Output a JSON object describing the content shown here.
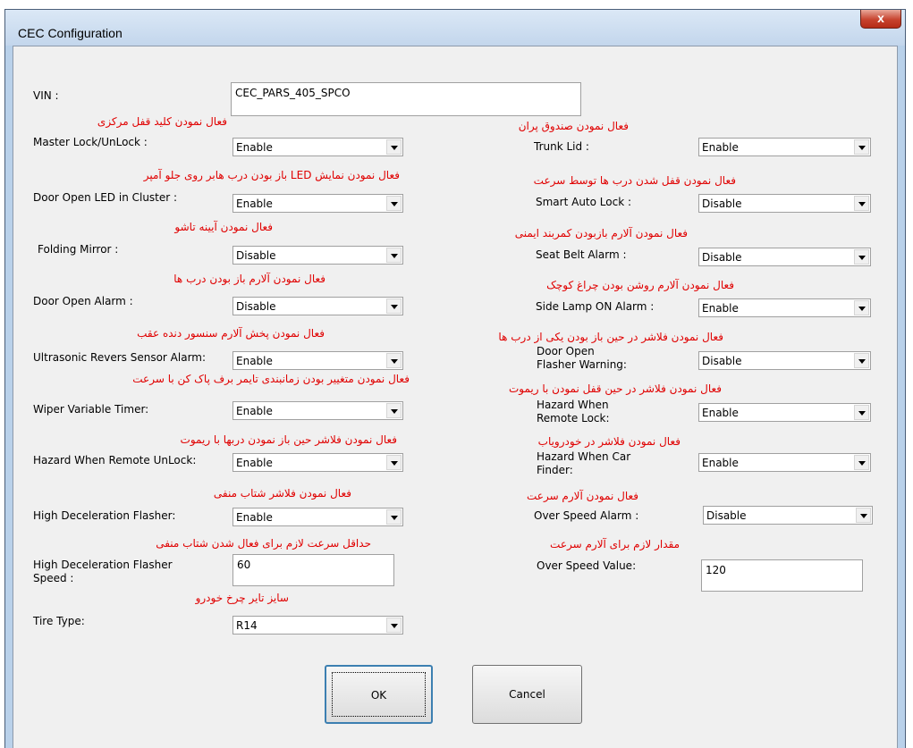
{
  "window": {
    "title": "CEC Configuration",
    "close_glyph": "x"
  },
  "vin": {
    "label": "VIN :",
    "value": "CEC_PARS_405_SPCO"
  },
  "left": {
    "master_lock": {
      "hint": "فعال نمودن کلید قفل مرکزی",
      "label": "Master Lock/UnLock :",
      "value": "Enable"
    },
    "door_led": {
      "hint": "فعال نمودن نمایش LED باز بودن درب هابر روی جلو آمپر",
      "label": "Door Open LED in Cluster :",
      "value": "Enable"
    },
    "folding_mirror": {
      "hint": "فعال نمودن آیینه تاشو",
      "label": "Folding Mirror :",
      "value": "Disable"
    },
    "door_alarm": {
      "hint": "فعال نمودن آلارم باز بودن درب ها",
      "label": "Door Open Alarm :",
      "value": "Disable"
    },
    "ultrasonic": {
      "hint": "فعال نمودن پخش آلارم سنسور دنده عقب",
      "label": "Ultrasonic Revers Sensor Alarm:",
      "value": "Enable"
    },
    "wiper": {
      "hint": "فعال نمودن متغییر بودن زمانبندی تایمر برف پاک کن با سرعت",
      "label": "Wiper Variable Timer:",
      "value": "Enable"
    },
    "hazard_unlock": {
      "hint": "فعال نمودن فلاشر حین باز نمودن دربها با ریموت",
      "label": "Hazard When Remote UnLock:",
      "value": "Enable"
    },
    "high_decel": {
      "hint": "فعال نمودن فلاشر شتاب منفی",
      "label": "High Deceleration Flasher:",
      "value": "Enable"
    },
    "high_decel_speed": {
      "hint": "حداقل سرعت لازم برای فعال شدن شتاب منفی",
      "label": "High Deceleration Flasher Speed :",
      "value": "60"
    },
    "tire_type": {
      "hint": "سایز تایر چرخ خودرو",
      "label": "Tire Type:",
      "value": "R14"
    }
  },
  "right": {
    "trunk_lid": {
      "hint": "فعال نمودن صندوق پران",
      "label": "Trunk Lid :",
      "value": "Enable"
    },
    "smart_auto_lock": {
      "hint": "فعال نمودن قفل شدن درب ها توسط سرعت",
      "label": "Smart Auto Lock :",
      "value": "Disable"
    },
    "seat_belt": {
      "hint": "فعال نمودن آلارم بازبودن کمربند ایمنی",
      "label": "Seat Belt Alarm :",
      "value": "Disable"
    },
    "side_lamp": {
      "hint": "فعال نمودن آلارم روشن بودن چراغ کوچک",
      "label": "Side Lamp ON Alarm :",
      "value": "Enable"
    },
    "door_flasher": {
      "hint": "فعال نمودن فلاشر در حین باز بودن یکی از درب ها",
      "label": "Door Open Flasher Warning:",
      "value": "Disable"
    },
    "hazard_lock": {
      "hint": "فعال نمودن فلاشر در حین قفل نمودن با ریموت",
      "label": "Hazard When Remote Lock:",
      "value": "Enable"
    },
    "hazard_car_finder": {
      "hint": "فعال نمودن فلاشر در خودرویاب",
      "label": "Hazard When Car Finder:",
      "value": "Enable"
    },
    "over_speed_alarm": {
      "hint": "فعال نمودن آلارم سرعت",
      "label": "Over Speed Alarm :",
      "value": "Disable"
    },
    "over_speed_value": {
      "hint": "مقدار لازم برای آلارم سرعت",
      "label": "Over Speed Value:",
      "value": "120"
    }
  },
  "buttons": {
    "ok": "OK",
    "cancel": "Cancel"
  }
}
